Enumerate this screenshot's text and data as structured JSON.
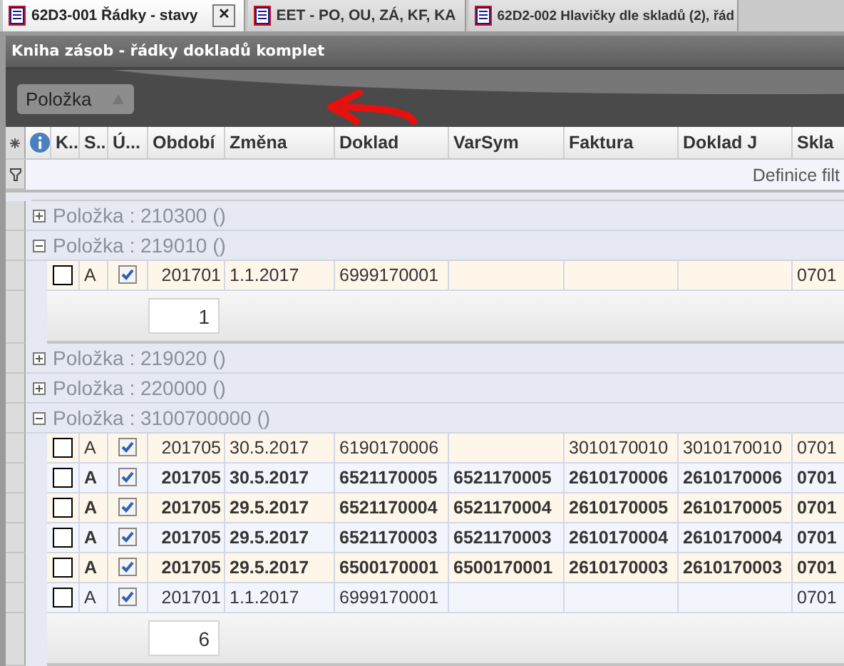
{
  "tabs": [
    {
      "label": "62D3-001 Řádky - stavy",
      "selected": true,
      "closable": true,
      "close_glyph": "✕"
    },
    {
      "label": "EET - PO, OU, ZÁ, KF, KA",
      "selected": false,
      "closable": false
    },
    {
      "label": "62D2-002 Hlavičky dle skladů (2), řád",
      "selected": false,
      "closable": false
    }
  ],
  "panel_title": "Kniha zásob - řádky dokladů komplet",
  "group_by": {
    "label": "Položka"
  },
  "table": {
    "columns": [
      "",
      "K..",
      "S..",
      "Ú...",
      "Období",
      "Změna",
      "Doklad",
      "VarSym",
      "Faktura",
      "Doklad J",
      "Skla"
    ],
    "filter_hint": "Definice filt",
    "groups": [
      {
        "label": "Položka : 210300 ()",
        "expanded": false
      },
      {
        "label": "Položka : 219010 ()",
        "expanded": true,
        "count": "1",
        "rows": [
          {
            "checked": false,
            "bold": false,
            "ucheck": true,
            "cells": [
              "A",
              "201701",
              "1.1.2017",
              "6999170001",
              "",
              "",
              "",
              "0701"
            ]
          }
        ]
      },
      {
        "label": "Položka : 219020 ()",
        "expanded": false
      },
      {
        "label": "Položka : 220000 ()",
        "expanded": false
      },
      {
        "label": "Položka : 3100700000 ()",
        "expanded": true,
        "count": "6",
        "rows": [
          {
            "checked": false,
            "bold": false,
            "ucheck": true,
            "cells": [
              "A",
              "201705",
              "30.5.2017",
              "6190170006",
              "",
              "3010170010",
              "3010170010",
              "0701"
            ]
          },
          {
            "checked": false,
            "bold": true,
            "ucheck": true,
            "cells": [
              "A",
              "201705",
              "30.5.2017",
              "6521170005",
              "6521170005",
              "2610170006",
              "2610170006",
              "0701"
            ]
          },
          {
            "checked": false,
            "bold": true,
            "ucheck": true,
            "cells": [
              "A",
              "201705",
              "29.5.2017",
              "6521170004",
              "6521170004",
              "2610170005",
              "2610170005",
              "0701"
            ]
          },
          {
            "checked": false,
            "bold": true,
            "ucheck": true,
            "cells": [
              "A",
              "201705",
              "29.5.2017",
              "6521170003",
              "6521170003",
              "2610170004",
              "2610170004",
              "0701"
            ]
          },
          {
            "checked": false,
            "bold": true,
            "ucheck": true,
            "cells": [
              "A",
              "201705",
              "29.5.2017",
              "6500170001",
              "6500170001",
              "2610170003",
              "2610170003",
              "0701"
            ]
          },
          {
            "checked": false,
            "bold": false,
            "ucheck": true,
            "cells": [
              "A",
              "201701",
              "1.1.2017",
              "6999170001",
              "",
              "",
              "",
              "0701"
            ]
          }
        ]
      }
    ]
  }
}
